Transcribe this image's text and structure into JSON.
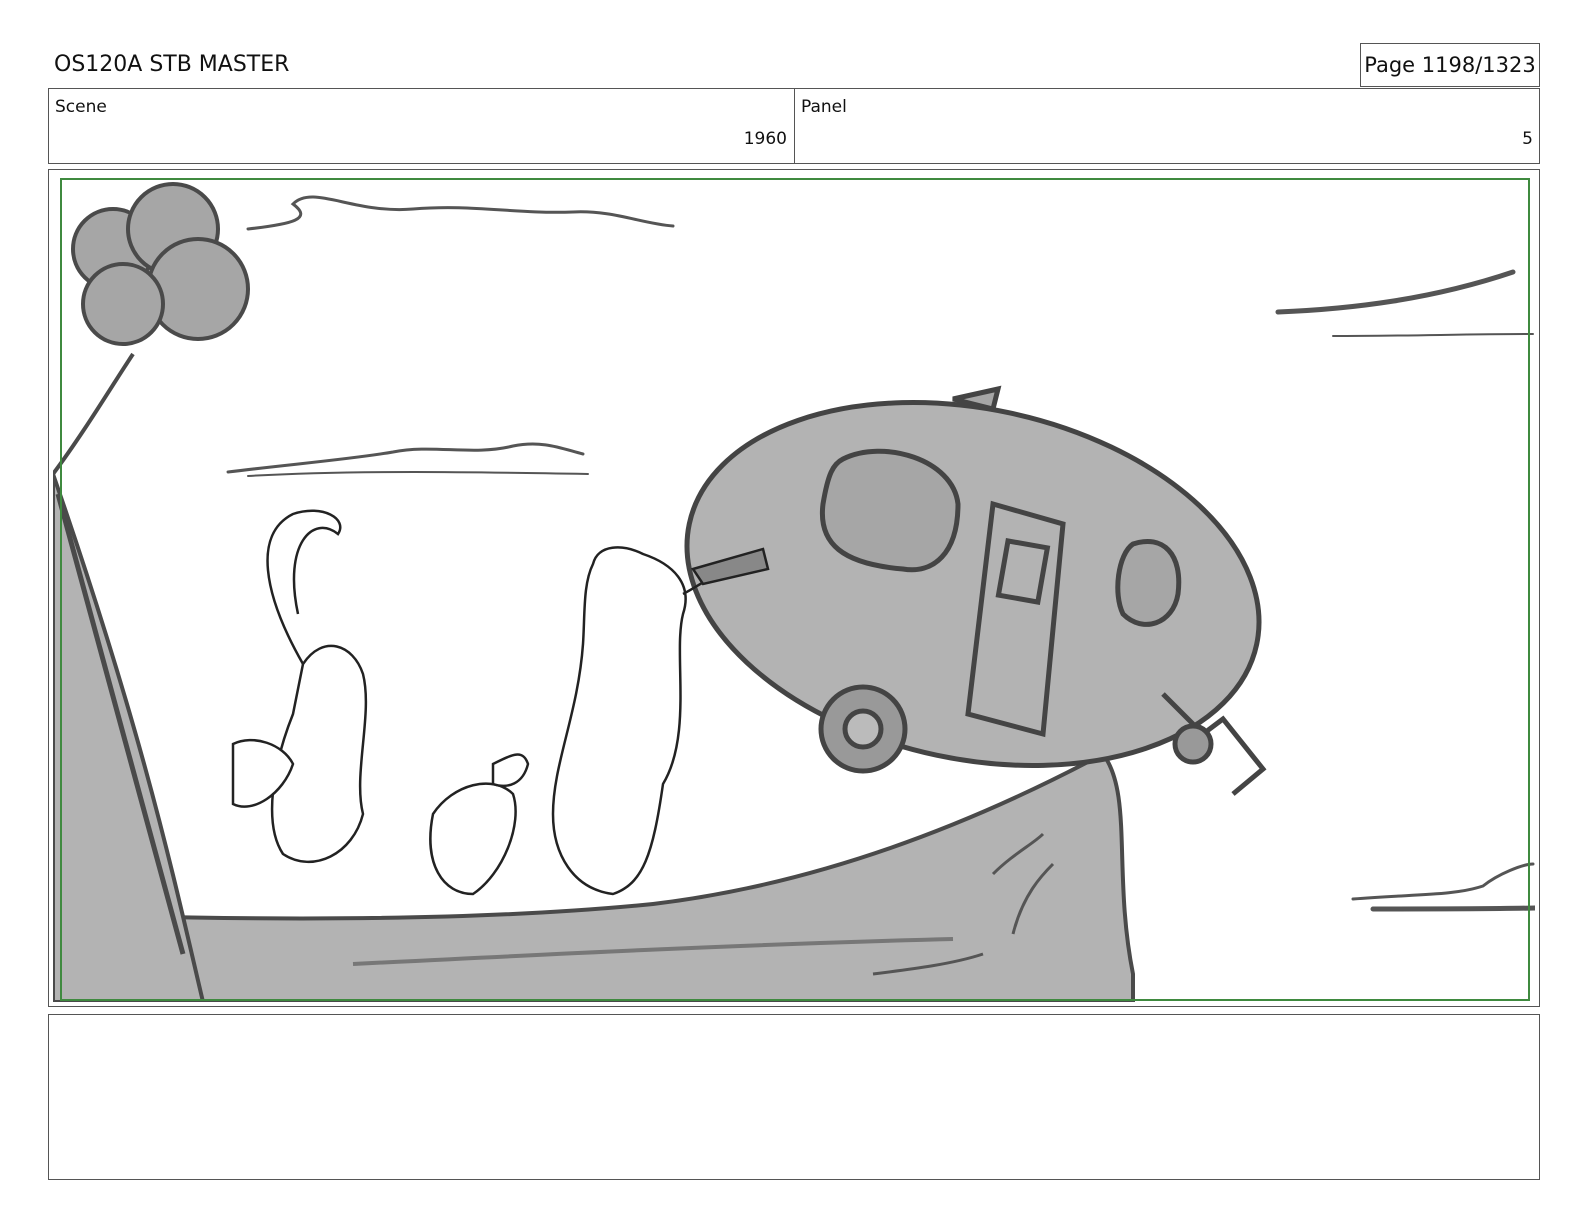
{
  "header": {
    "title": "OS120A STB MASTER",
    "page": "Page 1198/1323"
  },
  "info": {
    "scene_label": "Scene",
    "scene_value": "1960",
    "panel_label": "Panel",
    "panel_value": "5"
  },
  "notes": {
    "text": ""
  },
  "colors": {
    "safe_frame": "#3f8a3f",
    "sketch_fill": "#b3b3b3",
    "sketch_line": "#4a4a4a"
  }
}
